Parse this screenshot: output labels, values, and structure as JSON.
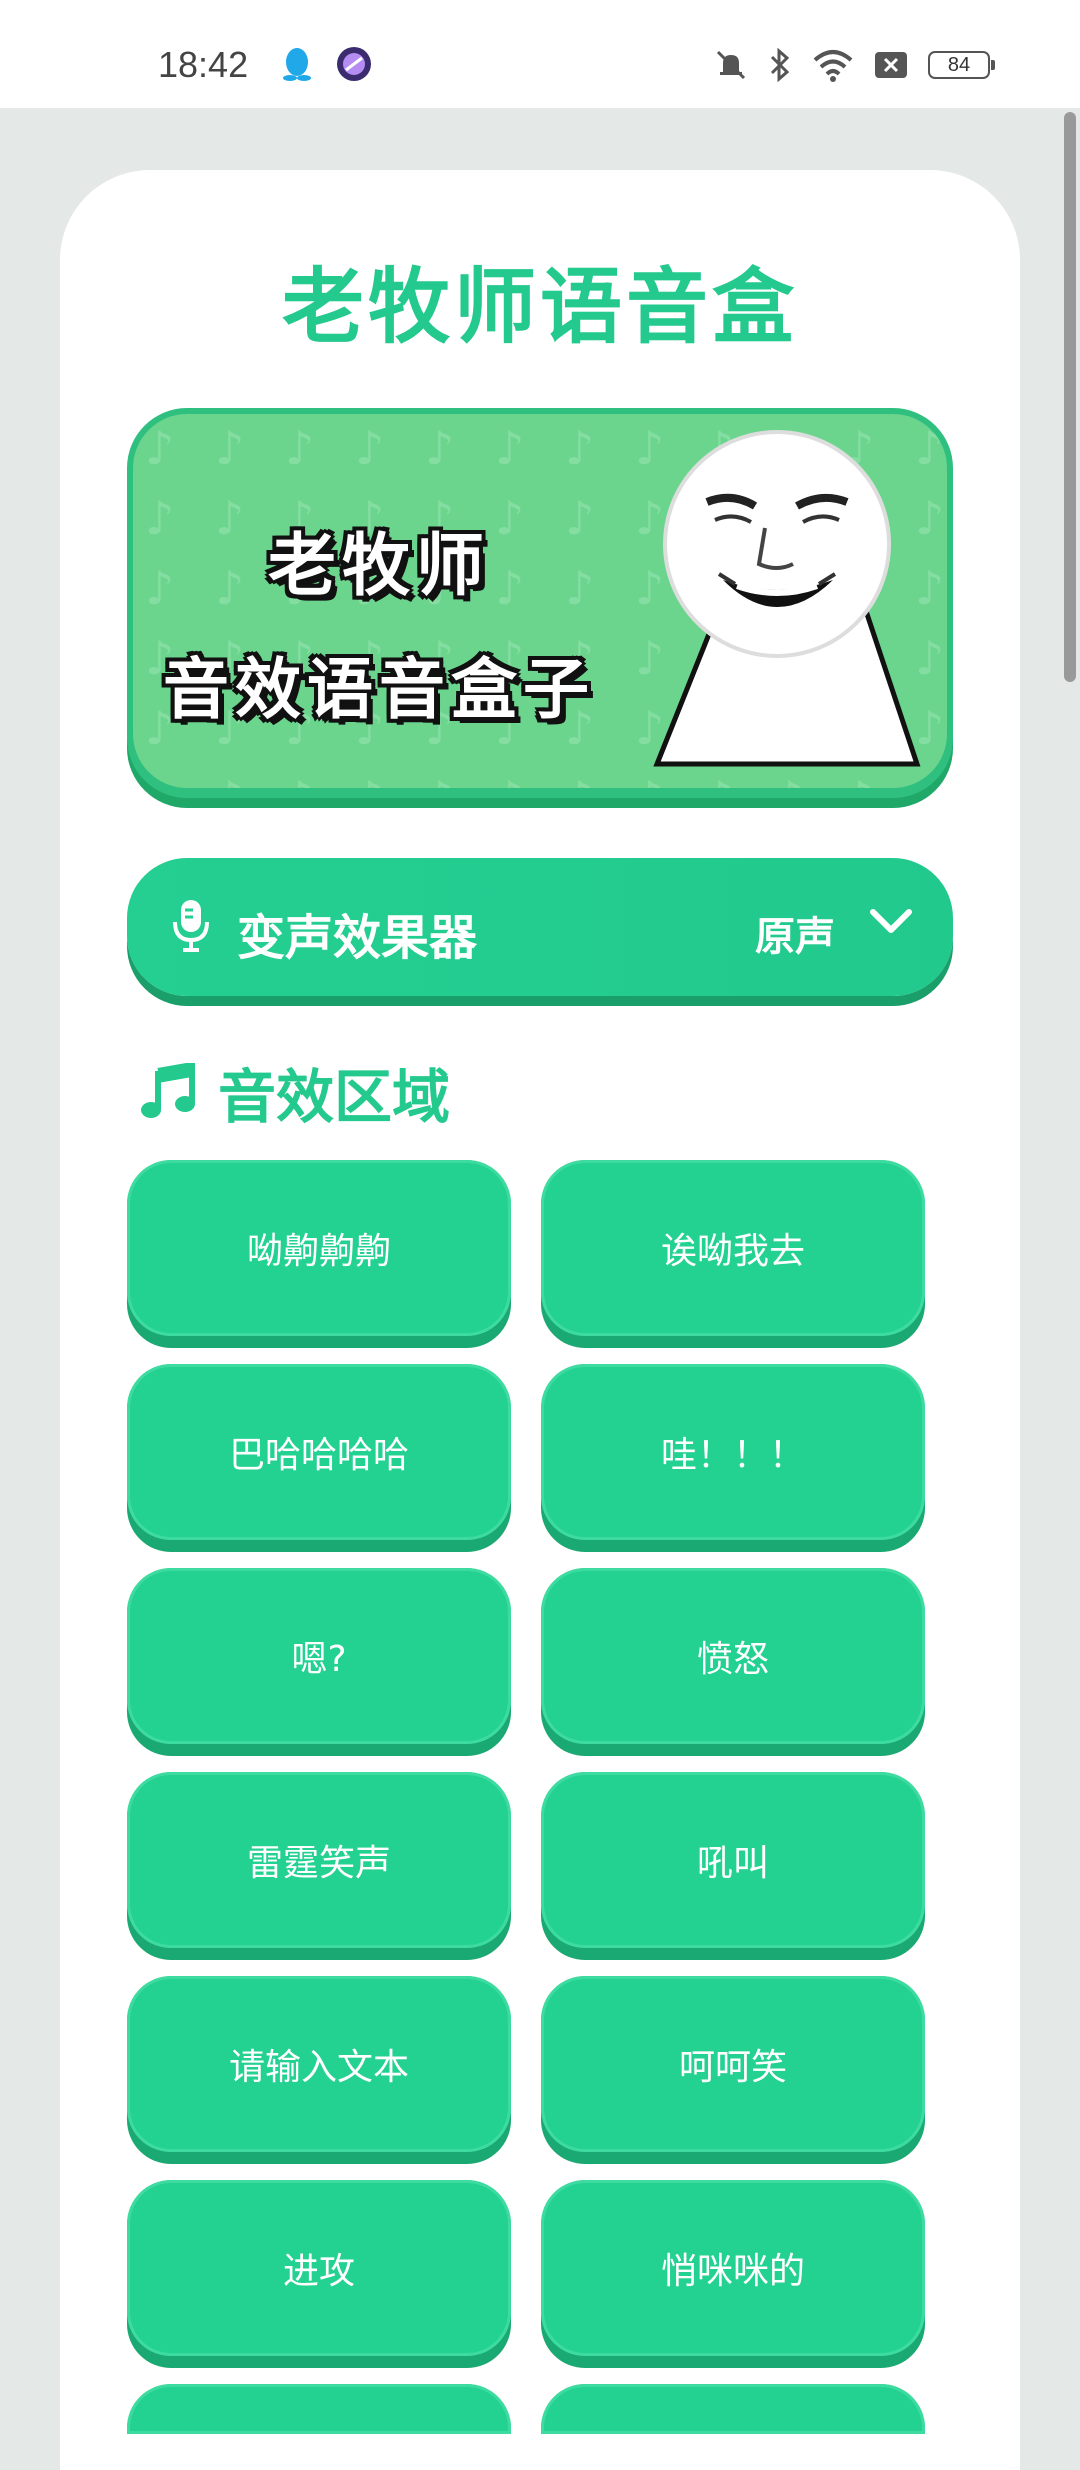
{
  "status_bar": {
    "time": "18:42",
    "battery": "84",
    "left_icons": [
      "qq-penguin-icon",
      "app-orb-icon"
    ],
    "right_icons": [
      "bell-muted-icon",
      "bluetooth-icon",
      "wifi-icon",
      "sim-blocked-icon",
      "battery-icon"
    ]
  },
  "app": {
    "title": "老牧师语音盒"
  },
  "banner": {
    "line1": "老牧师",
    "line2": "音效语音盒子"
  },
  "voice_changer": {
    "label": "变声效果器",
    "value": "原声",
    "icon": "microphone-icon"
  },
  "sound_section": {
    "icon": "music-note-icon",
    "title": "音效区域",
    "buttons": [
      "呦齁齁齁",
      "诶呦我去",
      "巴哈哈哈哈",
      "哇！！！",
      "嗯?",
      "愤怒",
      "雷霆笑声",
      "吼叫",
      "请输入文本",
      "呵呵笑",
      "进攻",
      "悄咪咪的"
    ]
  },
  "colors": {
    "accent": "#24c98e",
    "button": "#23d191",
    "button_shadow": "#1aa873",
    "background": "#e4e8e6",
    "card": "#ffffff"
  }
}
